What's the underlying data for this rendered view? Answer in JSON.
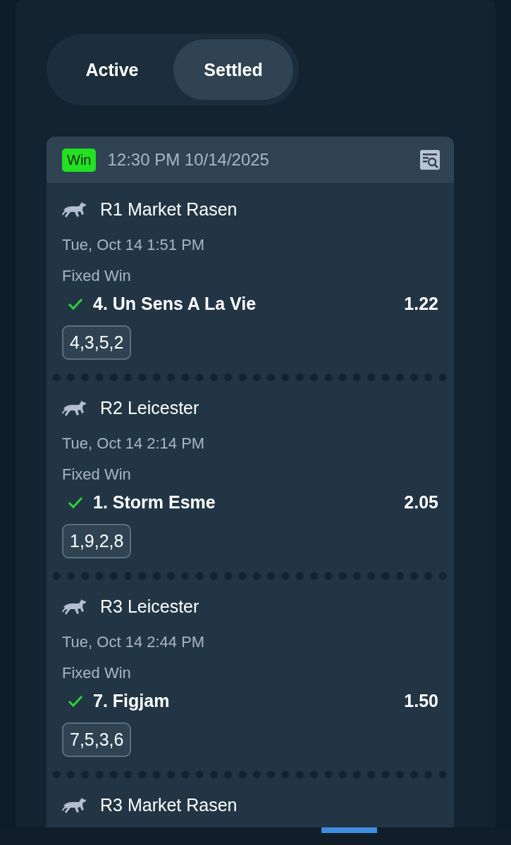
{
  "tabs": [
    {
      "label": "Active",
      "selected": false
    },
    {
      "label": "Settled",
      "selected": true
    }
  ],
  "bet": {
    "result": "Win",
    "placed": "12:30 PM 10/14/2025",
    "legs": [
      {
        "race": "R1 Market Rasen",
        "time": "Tue, Oct 14 1:51 PM",
        "bet_type": "Fixed Win",
        "selection": "4. Un Sens A La Vie",
        "won": true,
        "odds": "1.22",
        "finish": "4,3,5,2"
      },
      {
        "race": "R2 Leicester",
        "time": "Tue, Oct 14 2:14 PM",
        "bet_type": "Fixed Win",
        "selection": "1. Storm Esme",
        "won": true,
        "odds": "2.05",
        "finish": "1,9,2,8"
      },
      {
        "race": "R3 Leicester",
        "time": "Tue, Oct 14 2:44 PM",
        "bet_type": "Fixed Win",
        "selection": "7. Figjam",
        "won": true,
        "odds": "1.50",
        "finish": "7,5,3,6"
      },
      {
        "race": "R3 Market Rasen"
      }
    ]
  }
}
